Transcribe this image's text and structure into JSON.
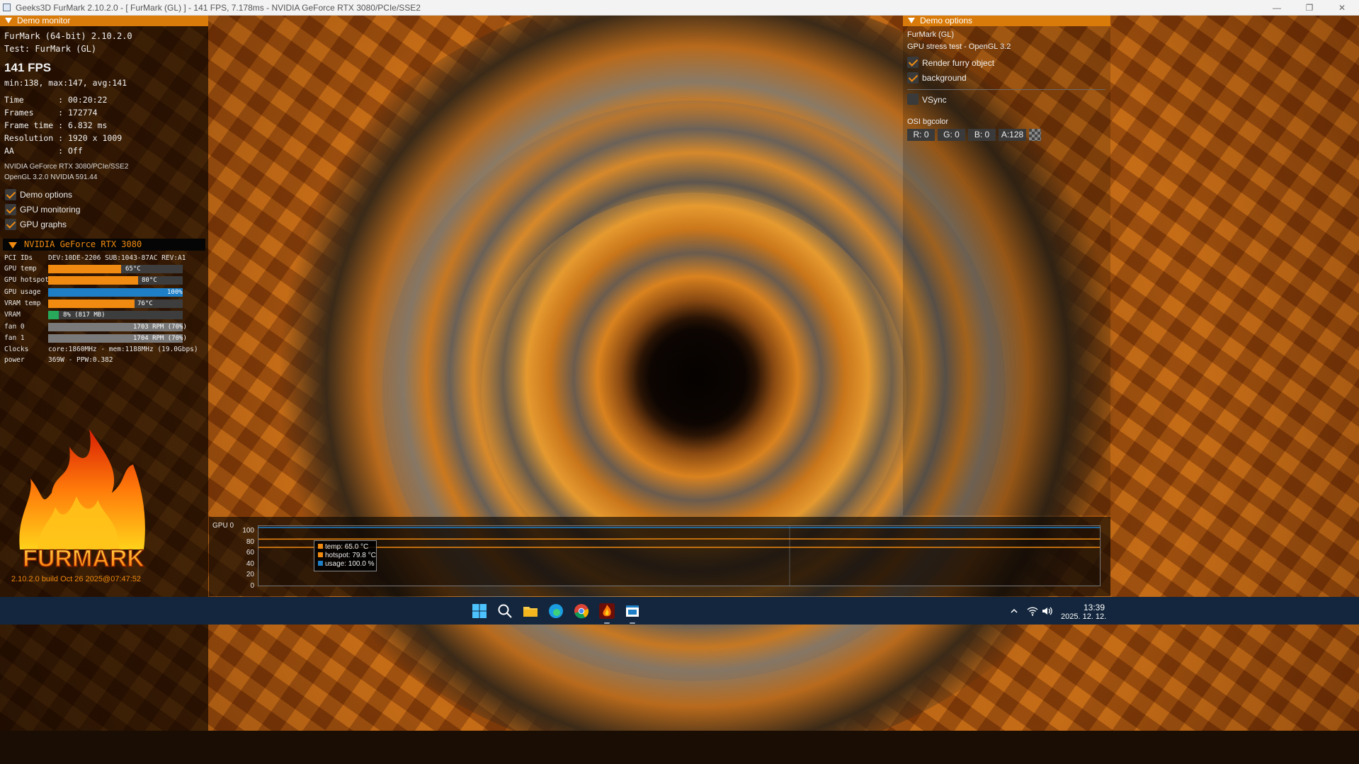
{
  "window": {
    "title": "Geeks3D FurMark 2.10.2.0 - [ FurMark (GL) ] - 141 FPS, 7.178ms - NVIDIA GeForce RTX 3080/PCIe/SSE2",
    "minimize": "—",
    "maximize": "❐",
    "close": "✕"
  },
  "demo_monitor": {
    "header": "Demo monitor",
    "app_line": "FurMark (64-bit) 2.10.2.0",
    "test_line": "Test: FurMark (GL)",
    "fps": "141 FPS",
    "fps_stats": "min:138, max:147, avg:141",
    "time": "Time       : 00:20:22",
    "frames": "Frames     : 172774",
    "frame_time": "Frame time : 6.832 ms",
    "resolution": "Resolution : 1920 x 1009",
    "aa": "AA         : Off",
    "renderer": "NVIDIA GeForce RTX 3080/PCIe/SSE2",
    "opengl": "OpenGL 3.2.0 NVIDIA 591.44",
    "checks": [
      {
        "label": "Demo options",
        "checked": true
      },
      {
        "label": "GPU monitoring",
        "checked": true
      },
      {
        "label": "GPU graphs",
        "checked": true
      }
    ]
  },
  "gpu": {
    "header": "NVIDIA GeForce RTX 3080",
    "pci_label": "PCI IDs",
    "pci_value": "DEV:10DE-2206 SUB:1043-87AC REV:A1",
    "stats": [
      {
        "label": "GPU temp",
        "value": "65°C",
        "fraction": 0.54,
        "color": "#f08a10"
      },
      {
        "label": "GPU hotspot",
        "value": "80°C",
        "fraction": 0.67,
        "color": "#f08a10"
      },
      {
        "label": "GPU usage",
        "value": "100%",
        "fraction": 1.0,
        "color": "#1f7fc6"
      },
      {
        "label": "VRAM temp",
        "value": "76°C",
        "fraction": 0.64,
        "color": "#f08a10"
      },
      {
        "label": "VRAM",
        "value": "8% (817 MB)",
        "fraction": 0.08,
        "color": "#27a85a"
      },
      {
        "label": "fan 0",
        "value": "1703 RPM (70%)",
        "fraction": 1.0,
        "color": "#7a7a7a"
      },
      {
        "label": "fan 1",
        "value": "1704 RPM (70%)",
        "fraction": 1.0,
        "color": "#7a7a7a"
      }
    ],
    "clocks_label": "Clocks",
    "clocks_value": "core:1860MHz - mem:1188MHz (19.0Gbps)",
    "power_label": "power",
    "power_value": "369W - PPW:0.382"
  },
  "logo": {
    "wordmark": "FURMARK",
    "build": "2.10.2.0 build Oct 26 2025@07:47:52"
  },
  "demo_options": {
    "header": "Demo options",
    "line1": "FurMark (GL)",
    "line2": "GPU stress test - OpenGL 3.2",
    "checks": [
      {
        "label": "Render furry object",
        "checked": true
      },
      {
        "label": "background",
        "checked": true
      },
      {
        "label": "VSync",
        "checked": false
      }
    ],
    "osi_label": "OSI bgcolor",
    "osi": {
      "r": "R: 0",
      "g": "G: 0",
      "b": "B: 0",
      "a": "A:128"
    }
  },
  "graph": {
    "label": "GPU 0",
    "ticks": [
      "100",
      "80",
      "60",
      "40",
      "20",
      "0"
    ],
    "legend": [
      {
        "label": "temp: 65.0 °C",
        "color": "#f08a10"
      },
      {
        "label": "hotspot: 79.8 °C",
        "color": "#f08a10"
      },
      {
        "label": "usage: 100.0 %",
        "color": "#1f7fc6"
      }
    ],
    "colors": {
      "temp": "#f08a10",
      "hotspot": "#f08a10",
      "usage": "#1f7fc6"
    }
  },
  "chart_data": {
    "type": "line",
    "title": "GPU 0",
    "ylim": [
      0,
      100
    ],
    "y_ticks": [
      100,
      80,
      60,
      40,
      20,
      0
    ],
    "series": [
      {
        "name": "temp",
        "current": 65.0,
        "unit": "°C",
        "values": [
          65,
          65,
          65,
          65,
          65,
          65,
          65,
          65
        ]
      },
      {
        "name": "hotspot",
        "current": 79.8,
        "unit": "°C",
        "values": [
          79.5,
          79.8,
          79.6,
          79.8,
          80,
          79.7,
          79.8,
          79.8
        ]
      },
      {
        "name": "usage",
        "current": 100.0,
        "unit": "%",
        "values": [
          100,
          100,
          100,
          100,
          100,
          100,
          100,
          100
        ]
      }
    ]
  },
  "taskbar": {
    "time": "13:39",
    "date": "2025. 12. 12.",
    "icons": [
      "windows-start-icon",
      "search-icon",
      "file-explorer-icon",
      "edge-icon",
      "chrome-icon",
      "furmark-icon",
      "app-window-icon"
    ],
    "tray": [
      "chevron-up-icon",
      "wifi-icon",
      "volume-icon"
    ]
  }
}
